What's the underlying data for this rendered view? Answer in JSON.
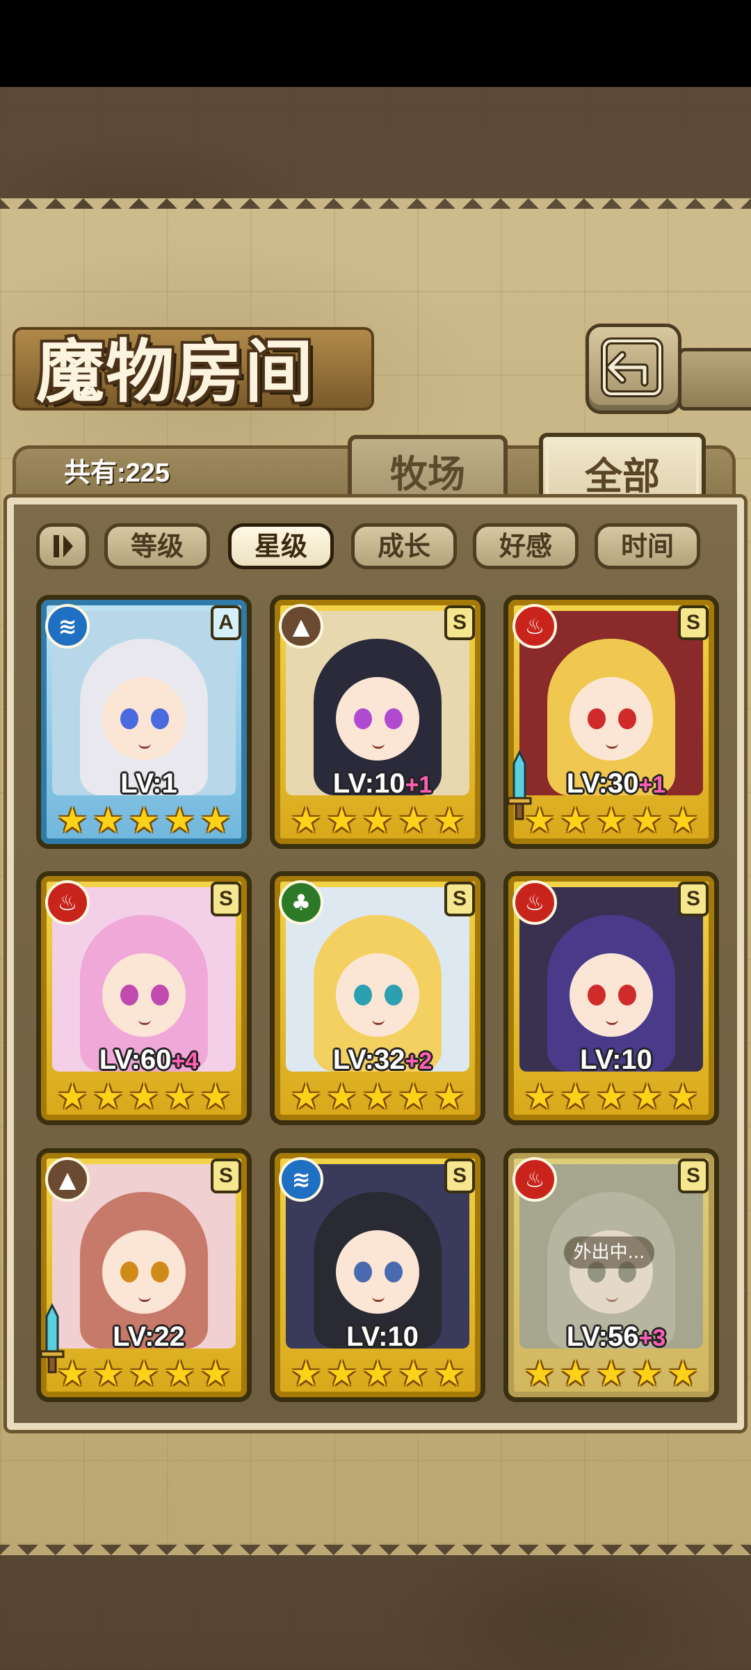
{
  "title": "魔物房间",
  "count_label": "共有:225",
  "tabs": {
    "pasture": "牧场",
    "all": "全部"
  },
  "sort_buttons": [
    "等级",
    "星级",
    "成长",
    "好感",
    "时间"
  ],
  "active_sort": "星级",
  "colors": {
    "gold_frame": "#f2d44a",
    "blue_frame": "#bfe4f4",
    "plus_pink": "#ff5fb4",
    "star": "#ffd21a"
  },
  "cards": [
    {
      "element": "water",
      "rank": "A",
      "frame": "blue",
      "lv": "LV:1",
      "plus": "",
      "stars": 5,
      "weapon": false,
      "away": ""
    },
    {
      "element": "earth",
      "rank": "S",
      "frame": "gold",
      "lv": "LV:10",
      "plus": "+1",
      "stars": 5,
      "weapon": false,
      "away": ""
    },
    {
      "element": "fire",
      "rank": "S",
      "frame": "gold",
      "lv": "LV:30",
      "plus": "+1",
      "stars": 5,
      "weapon": true,
      "away": ""
    },
    {
      "element": "fire",
      "rank": "S",
      "frame": "gold",
      "lv": "LV:60",
      "plus": "+4",
      "stars": 5,
      "weapon": false,
      "away": ""
    },
    {
      "element": "wood",
      "rank": "S",
      "frame": "gold",
      "lv": "LV:32",
      "plus": "+2",
      "stars": 5,
      "weapon": false,
      "away": ""
    },
    {
      "element": "fire",
      "rank": "S",
      "frame": "gold",
      "lv": "LV:10",
      "plus": "",
      "stars": 5,
      "weapon": false,
      "away": ""
    },
    {
      "element": "earth",
      "rank": "S",
      "frame": "gold",
      "lv": "LV:22",
      "plus": "",
      "stars": 5,
      "weapon": true,
      "away": ""
    },
    {
      "element": "water",
      "rank": "S",
      "frame": "gold",
      "lv": "LV:10",
      "plus": "",
      "stars": 5,
      "weapon": false,
      "away": ""
    },
    {
      "element": "fire",
      "rank": "S",
      "frame": "gold",
      "lv": "LV:56",
      "plus": "+3",
      "stars": 5,
      "weapon": false,
      "away": "外出中..."
    }
  ]
}
